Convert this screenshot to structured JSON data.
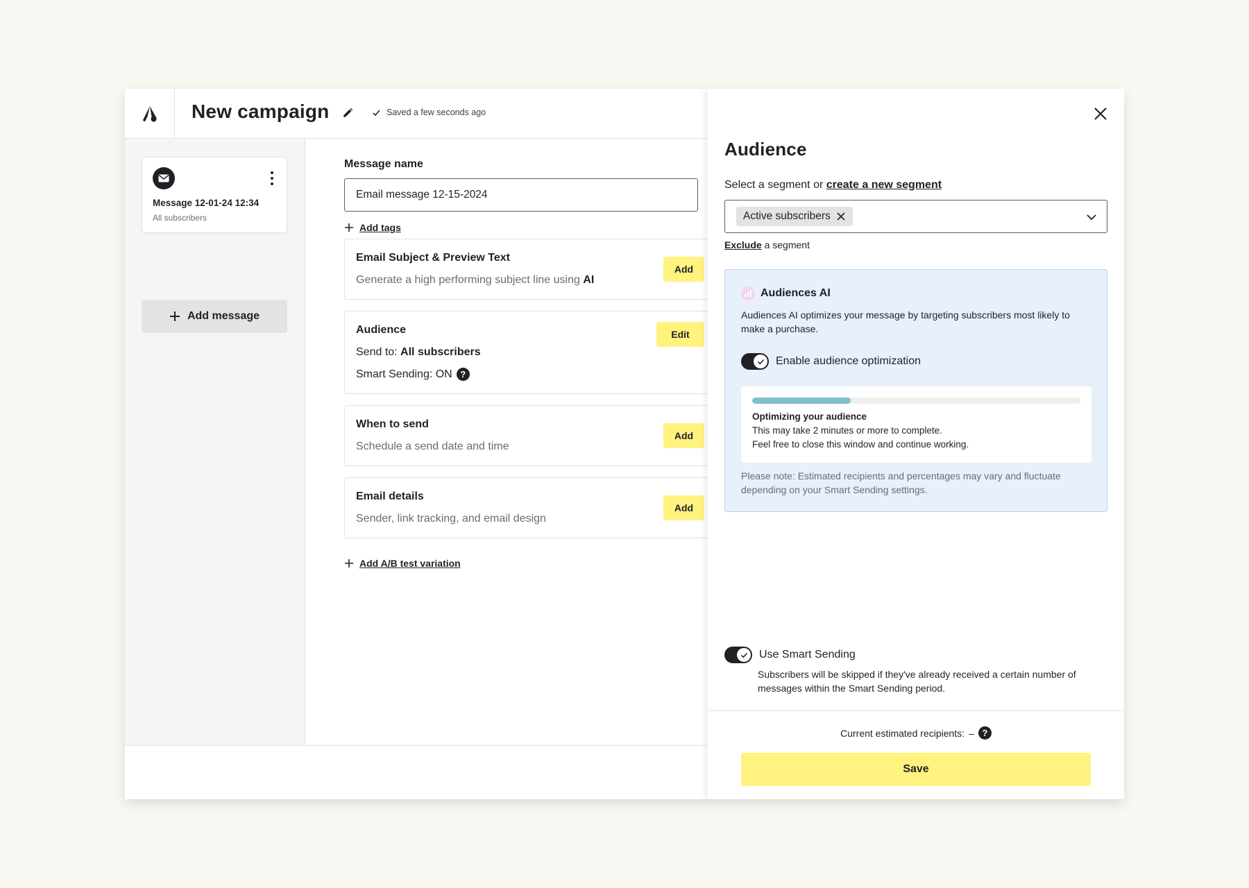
{
  "header": {
    "title": "New campaign",
    "saved_status": "Saved a few seconds ago",
    "icons": {
      "logo": "brand-logo-icon",
      "edit": "pencil-icon",
      "saved": "check-icon"
    }
  },
  "sidebar": {
    "message_card": {
      "title": "Message 12-01-24 12:34",
      "subtitle": "All subscribers",
      "icon": "mail-icon"
    },
    "add_message_label": "Add message"
  },
  "main": {
    "message_name_label": "Message name",
    "message_name_value": "Email message 12-15-2024",
    "add_tags_label": "Add tags",
    "sections": {
      "subject": {
        "title": "Email Subject & Preview Text",
        "desc_prefix": "Generate a high performing subject line using ",
        "desc_emphasis": "AI",
        "button": "Add"
      },
      "audience": {
        "title": "Audience",
        "send_to_label": "Send to: ",
        "send_to_value": "All subscribers",
        "smart_sending": "Smart Sending: ON",
        "button": "Edit"
      },
      "when": {
        "title": "When to send",
        "desc": "Schedule a send date and time",
        "button": "Add"
      },
      "details": {
        "title": "Email details",
        "desc": "Sender, link tracking, and email design",
        "button": "Add"
      }
    },
    "add_ab_label": "Add A/B test variation"
  },
  "panel": {
    "title": "Audience",
    "segment_prompt": "Select a segment or ",
    "segment_link": "create a new segment",
    "selected_segment": "Active subscribers",
    "exclude_link": "Exclude",
    "exclude_suffix": " a segment",
    "ai": {
      "title": "Audiences AI",
      "description": "Audiences AI optimizes your message by targeting subscribers most likely to make a purchase.",
      "toggle_label": "Enable audience optimization",
      "toggle_on": true,
      "progress_fraction": 0.3,
      "progress_title": "Optimizing your audience",
      "progress_line1": "This may take 2 minutes or more to complete.",
      "progress_line2": "Feel free to close this window and continue working.",
      "note": "Please note: Estimated recipients and percentages may vary and fluctuate depending on your Smart Sending settings."
    },
    "smart_sending": {
      "label": "Use Smart Sending",
      "on": true,
      "description": "Subscribers will be skipped if they've already received a certain number of messages within the Smart Sending period."
    },
    "recipients_label": "Current estimated recipients:",
    "recipients_value": "–",
    "save_label": "Save"
  },
  "colors": {
    "accent_yellow": "#fff27f",
    "ai_box_bg": "#e7f0fb",
    "progress_fill": "#7ec1ca",
    "text_primary": "#1f2126"
  }
}
